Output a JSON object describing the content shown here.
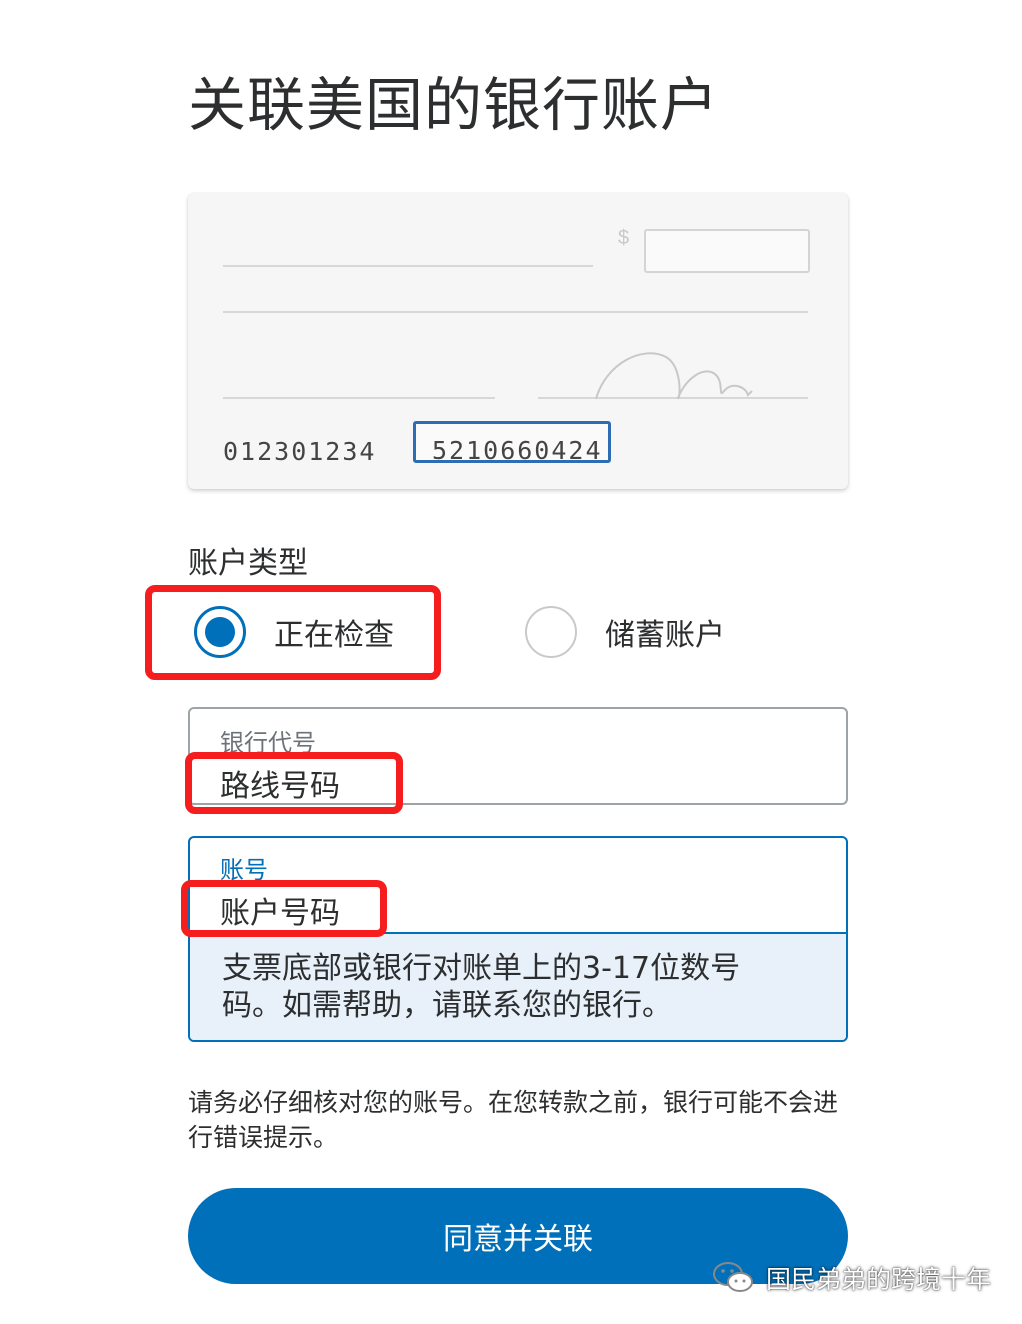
{
  "page": {
    "title": "关联美国的银行账户"
  },
  "check_illustration": {
    "currency_symbol": "$",
    "routing_number": "012301234",
    "account_number": "5210660424"
  },
  "account_type": {
    "label": "账户类型",
    "options": [
      {
        "label": "正在检查",
        "selected": true
      },
      {
        "label": "储蓄账户",
        "selected": false
      }
    ]
  },
  "routing_field": {
    "label": "银行代号",
    "value": "路线号码"
  },
  "account_field": {
    "label": "账号",
    "value": "账户号码",
    "helper": "支票底部或银行对账单上的3-17位数号码。如需帮助，请联系您的银行。"
  },
  "notice": "请务必仔细核对您的账号。在您转款之前，银行可能不会进行错误提示。",
  "submit_button": {
    "label": "同意并关联"
  },
  "watermark": {
    "text": "国民弟弟的跨境十年",
    "icon": "wechat-icon"
  },
  "colors": {
    "primary": "#0070ba",
    "highlight": "#f51d1d"
  }
}
